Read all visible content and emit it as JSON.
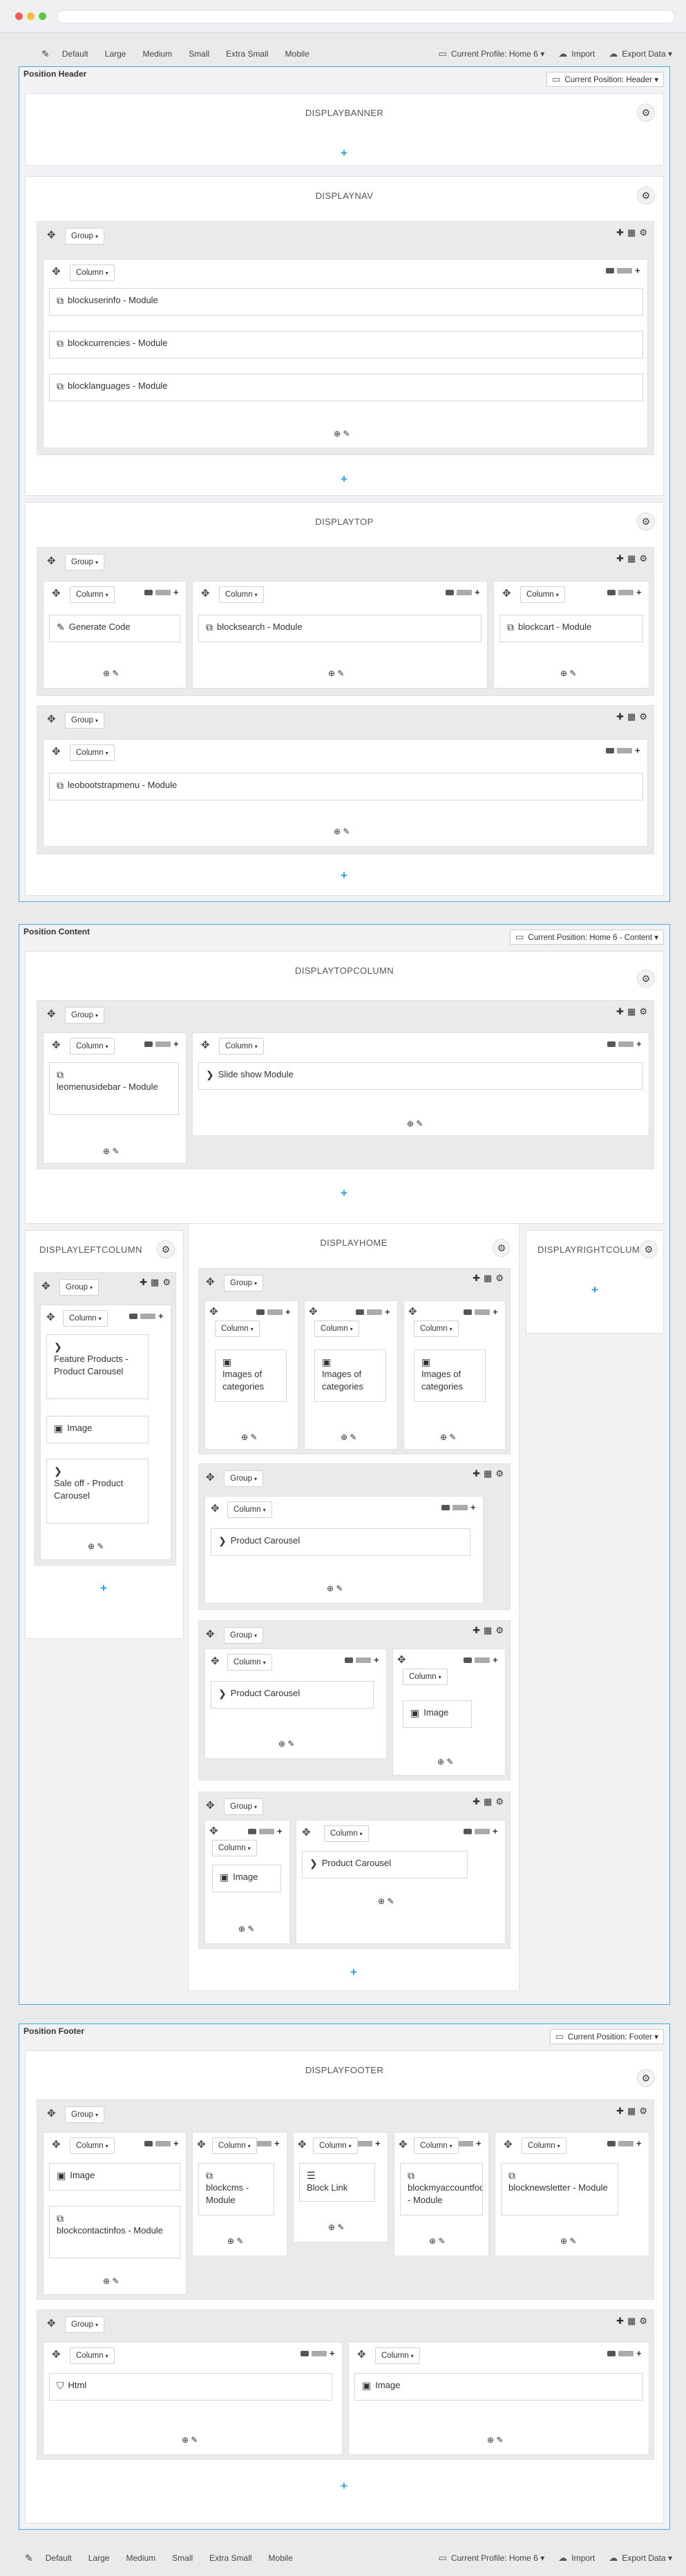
{
  "toolbar": {
    "devices": [
      "Default",
      "Large",
      "Medium",
      "Small",
      "Extra Small",
      "Mobile"
    ],
    "profile": "Current Profile: Home 6",
    "import": "Import",
    "export": "Export Data"
  },
  "ui": {
    "group": "Group",
    "column": "Column",
    "caret": "▾",
    "add": "+",
    "gear": "⚙",
    "move": "✥"
  },
  "sections": {
    "header": {
      "title": "Position Header",
      "position": "Current Position: Header"
    },
    "content": {
      "title": "Position Content",
      "position": "Current Position: Home 6 - Content"
    },
    "footer": {
      "title": "Position Footer",
      "position": "Current Position: Footer"
    }
  },
  "hooks": {
    "displaybanner": "DISPLAYBANNER",
    "displaynav": "DISPLAYNAV",
    "displaytop": "DISPLAYTOP",
    "displaytopcolumn": "DISPLAYTOPCOLUMN",
    "displayleftcolumn": "DISPLAYLEFTCOLUMN",
    "displayhome": "DISPLAYHOME",
    "displayrightcolumn": "DISPLAYRIGHTCOLUMN",
    "displayfooter": "DISPLAYFOOTER"
  },
  "modules": {
    "blockuserinfo": "blockuserinfo - Module",
    "blockcurrencies": "blockcurrencies - Module",
    "blocklanguages": "blocklanguages - Module",
    "generate_code": "Generate Code",
    "blocksearch": "blocksearch - Module",
    "blockcart": "blockcart - Module",
    "leobootstrapmenu": "leobootstrapmenu - Module",
    "leomenusidebar": "leomenusidebar - Module",
    "slideshow": "Slide show Module",
    "feature_products": "Feature Products - Product Carousel",
    "image": "Image",
    "sale_off": "Sale off - Product Carousel",
    "images_of_categories": "Images of categories",
    "product_carousel": "Product Carousel",
    "blockcms": "blockcms - Module",
    "block_link": "Block Link",
    "blockmyaccountfooter": "blockmyaccountfooter - Module",
    "blocknewsletter": "blocknewsletter - Module",
    "blockcontactinfos": "blockcontactinfos - Module",
    "html": "Html"
  }
}
